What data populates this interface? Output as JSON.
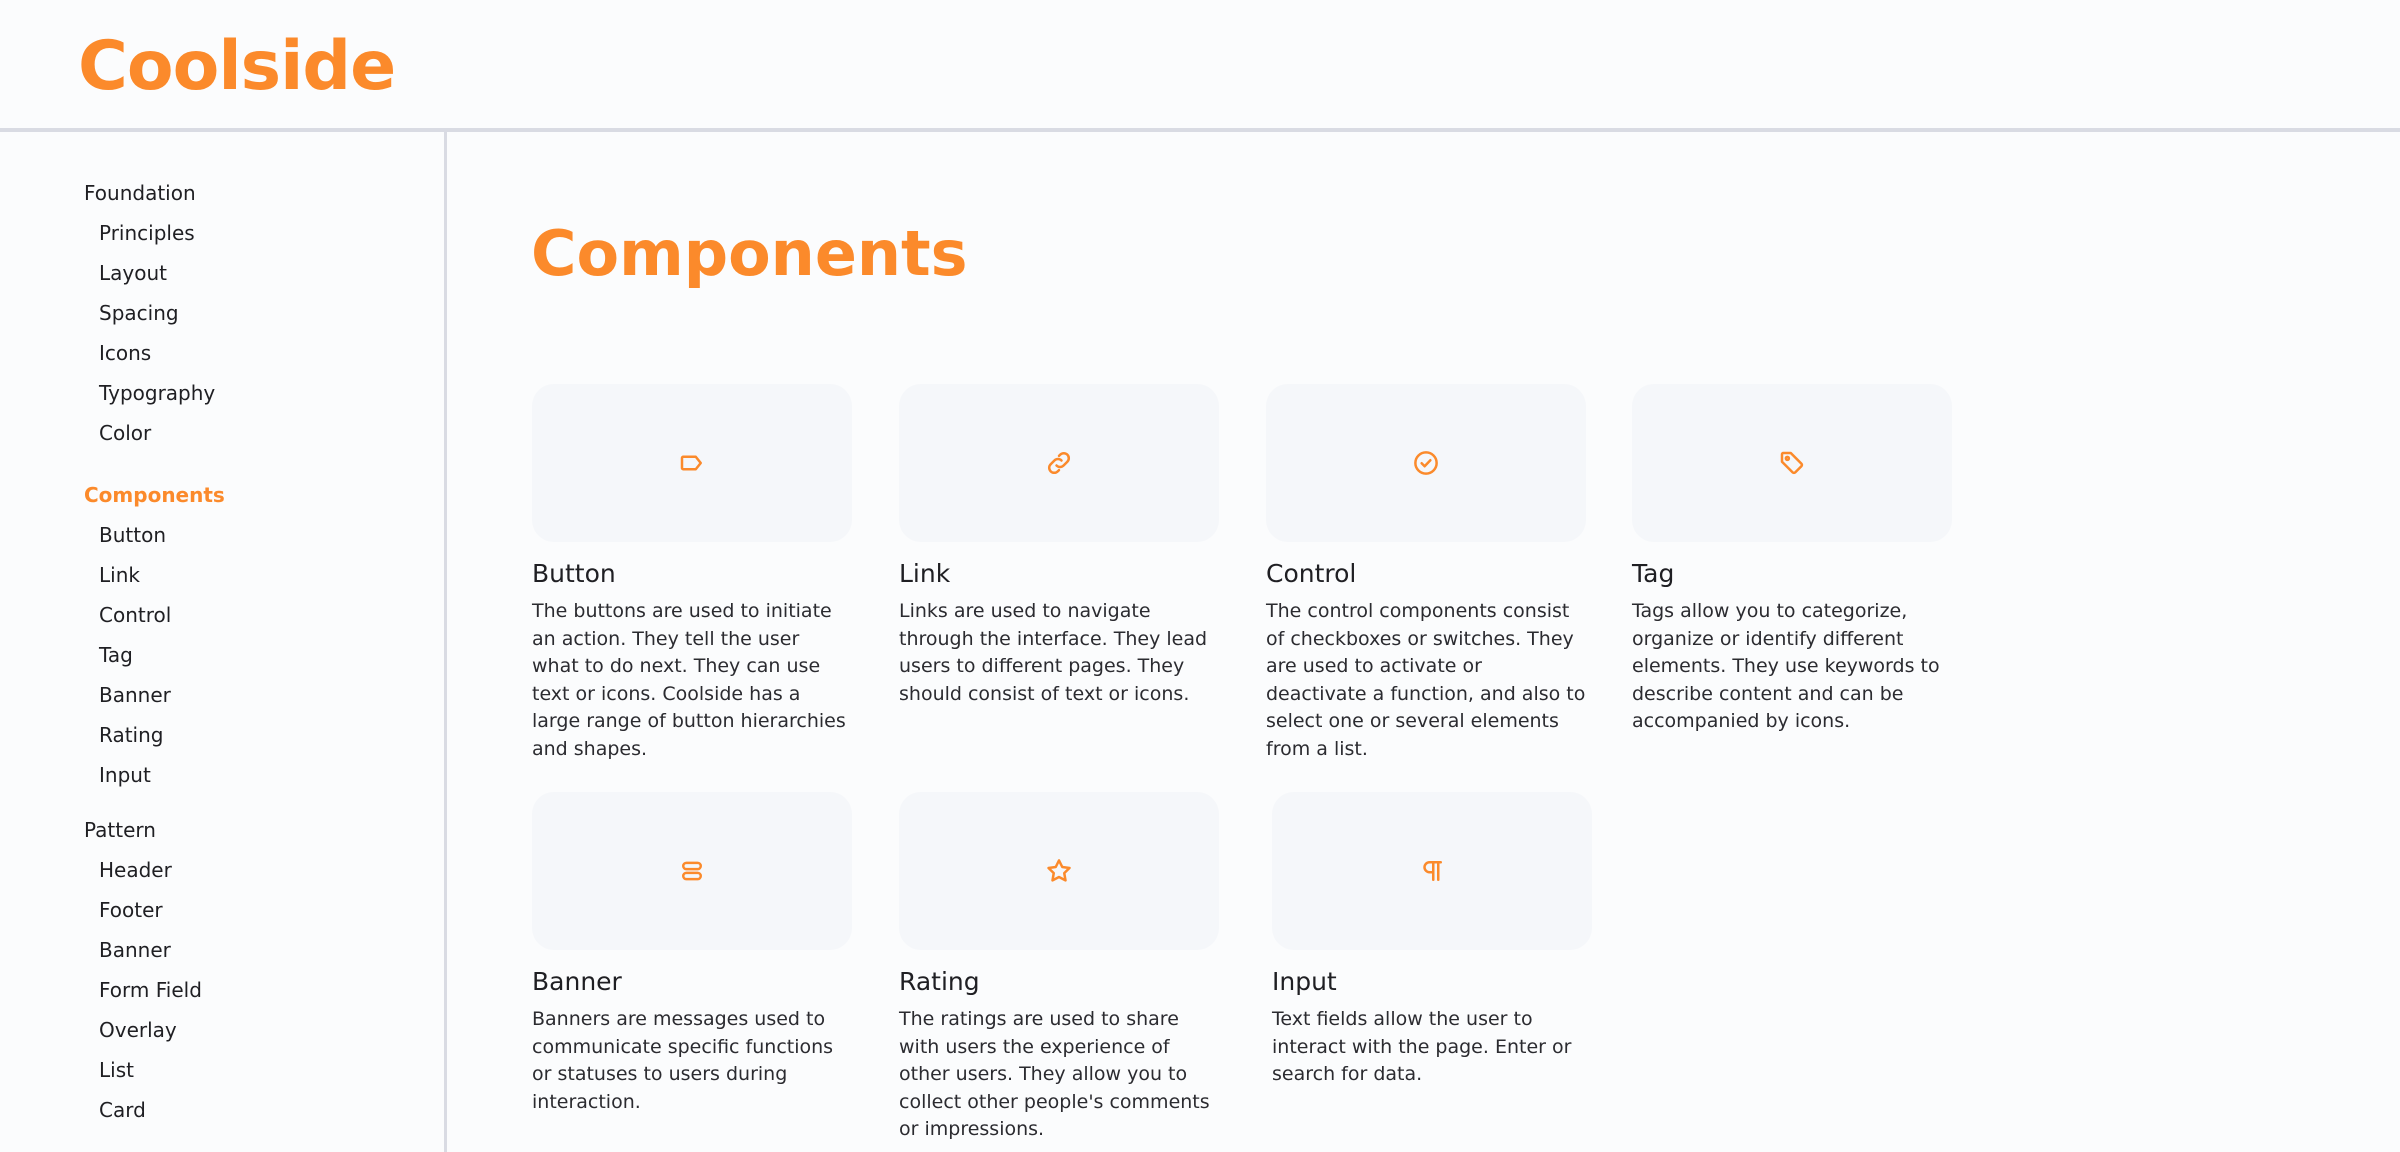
{
  "header": {
    "logo": "Coolside"
  },
  "sidebar": {
    "groups": [
      {
        "title": "Foundation",
        "items": [
          "Principles",
          "Layout",
          "Spacing",
          "Icons",
          "Typography",
          "Color"
        ]
      },
      {
        "title": "Components",
        "items": [
          "Button",
          "Link",
          "Control",
          "Tag",
          "Banner",
          "Rating",
          "Input"
        ]
      },
      {
        "title": "Pattern",
        "items": [
          "Header",
          "Footer",
          "Banner",
          "Form Field",
          "Overlay",
          "List",
          "Card"
        ]
      }
    ],
    "active_group": "Components"
  },
  "main": {
    "title": "Components",
    "accent_color": "#fb8a2b",
    "cards": [
      {
        "icon": "button-icon",
        "title": "Button",
        "description": "The buttons are used to initiate an action. They tell the user what to do next. They can use text or icons. Coolside has a large range of button hierarchies and shapes."
      },
      {
        "icon": "link-icon",
        "title": "Link",
        "description": "Links are used to navigate through the interface. They lead users to different pages. They should consist of text or icons."
      },
      {
        "icon": "check-circle-icon",
        "title": "Control",
        "description": "The control components consist of checkboxes or switches. They are used to activate or deactivate a function, and also to select one or several elements from a list."
      },
      {
        "icon": "tag-icon",
        "title": "Tag",
        "description": "Tags allow you to categorize, organize or identify different elements. They use keywords to describe content and can be accompanied by icons."
      },
      {
        "icon": "banner-icon",
        "title": "Banner",
        "description": "Banners are messages used to communicate specific functions or statuses to users during interaction."
      },
      {
        "icon": "star-icon",
        "title": "Rating",
        "description": "The ratings are used to share with users the experience of other users. They allow you to collect other people's comments or impressions."
      },
      {
        "icon": "pilcrow-icon",
        "title": "Input",
        "description": "Text fields allow the user to interact with the page. Enter or search for data."
      }
    ]
  }
}
